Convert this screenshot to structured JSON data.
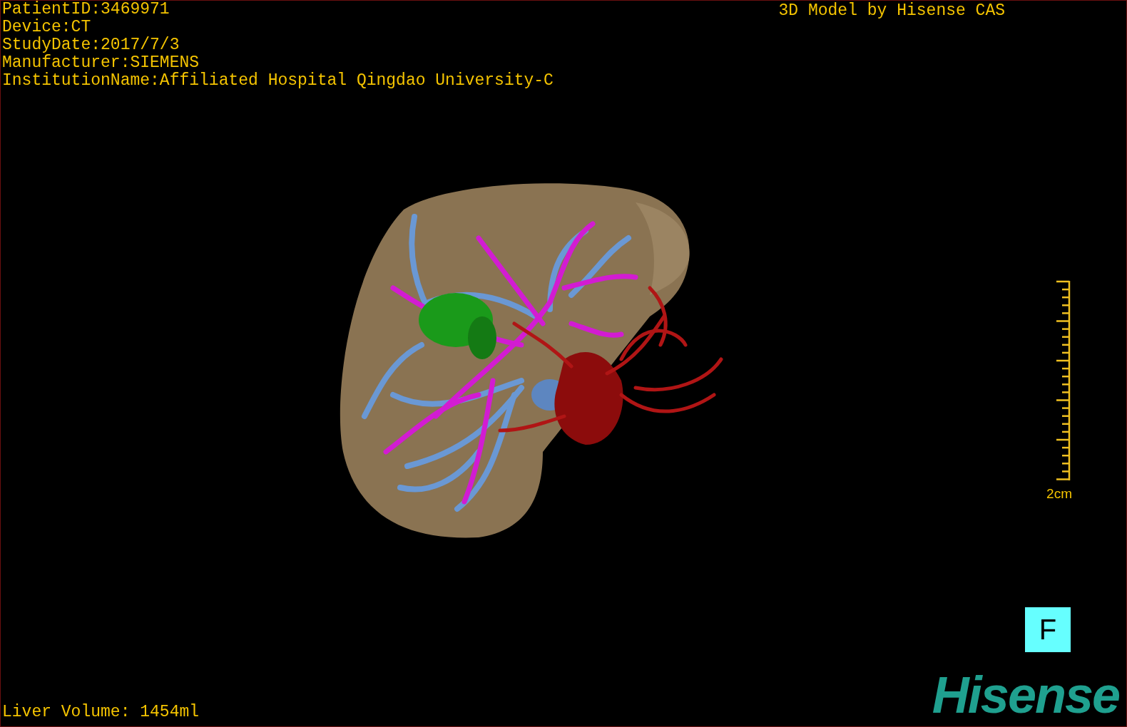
{
  "study_info": [
    "PatientID:3469971",
    "Device:CT",
    "StudyDate:2017/7/3",
    "Manufacturer:SIEMENS",
    "InstitutionName:Affiliated Hospital Qingdao University-C"
  ],
  "viewer_title": "3D Model by Hisense CAS",
  "scale_bar": {
    "label": "2cm"
  },
  "view_button": {
    "label": "F"
  },
  "liver_volume": "Liver Volume: 1454ml",
  "logo": "Hisense"
}
